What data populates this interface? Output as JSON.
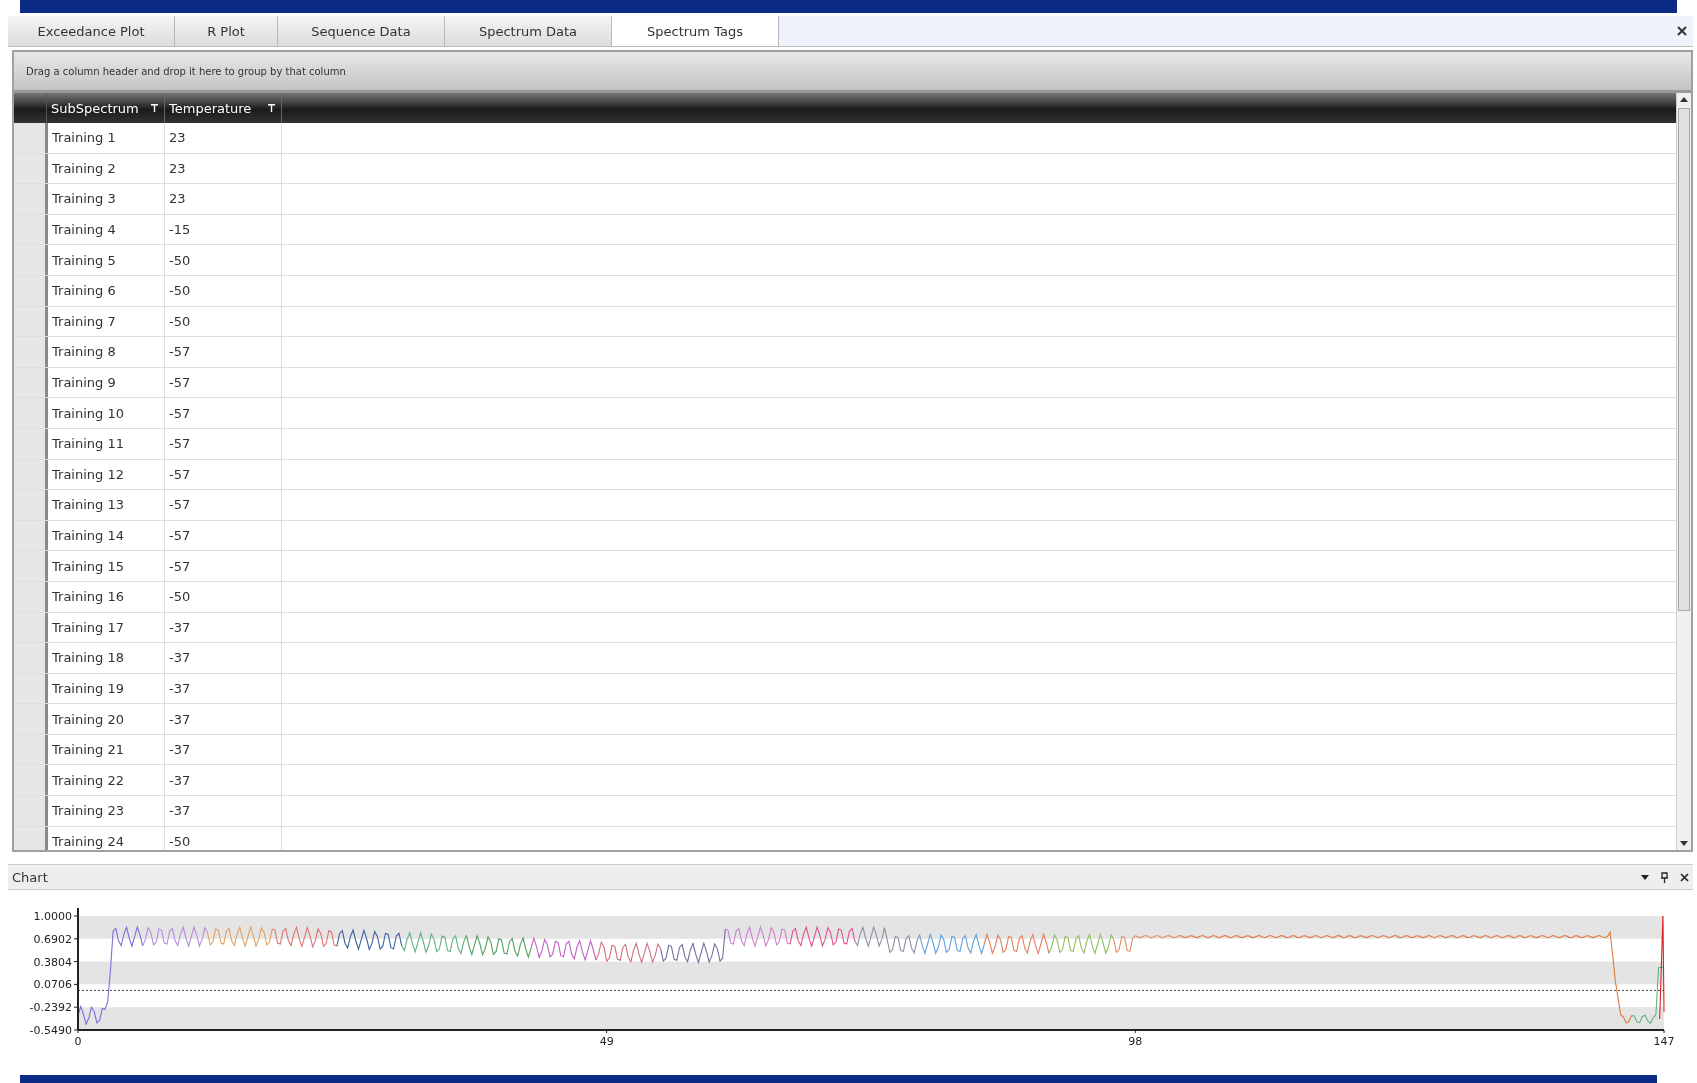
{
  "tabs": [
    {
      "label": "Exceedance Plot",
      "selected": false
    },
    {
      "label": "R Plot",
      "selected": false
    },
    {
      "label": "Sequence Data",
      "selected": false
    },
    {
      "label": "Spectrum Data",
      "selected": false
    },
    {
      "label": "Spectrum Tags",
      "selected": true
    }
  ],
  "group_panel": {
    "hint": "Drag a column header and drop it here to group by that column"
  },
  "table": {
    "columns": [
      "SubSpectrum",
      "Temperature"
    ],
    "rows": [
      [
        "Training 1",
        "23"
      ],
      [
        "Training 2",
        "23"
      ],
      [
        "Training 3",
        "23"
      ],
      [
        "Training 4",
        "-15"
      ],
      [
        "Training 5",
        "-50"
      ],
      [
        "Training 6",
        "-50"
      ],
      [
        "Training 7",
        "-50"
      ],
      [
        "Training 8",
        "-57"
      ],
      [
        "Training 9",
        "-57"
      ],
      [
        "Training 10",
        "-57"
      ],
      [
        "Training 11",
        "-57"
      ],
      [
        "Training 12",
        "-57"
      ],
      [
        "Training 13",
        "-57"
      ],
      [
        "Training 14",
        "-57"
      ],
      [
        "Training 15",
        "-57"
      ],
      [
        "Training 16",
        "-50"
      ],
      [
        "Training 17",
        "-37"
      ],
      [
        "Training 18",
        "-37"
      ],
      [
        "Training 19",
        "-37"
      ],
      [
        "Training 20",
        "-37"
      ],
      [
        "Training 21",
        "-37"
      ],
      [
        "Training 22",
        "-37"
      ],
      [
        "Training 23",
        "-37"
      ],
      [
        "Training 24",
        "-50"
      ]
    ]
  },
  "chart_panel": {
    "title": "Chart",
    "y_tick_labels": [
      "1.0000",
      "0.6902",
      "0.3804",
      "0.0706",
      "-0.2392",
      "-0.5490"
    ],
    "x_tick_labels": [
      "0",
      "49",
      "98",
      "147"
    ]
  }
}
